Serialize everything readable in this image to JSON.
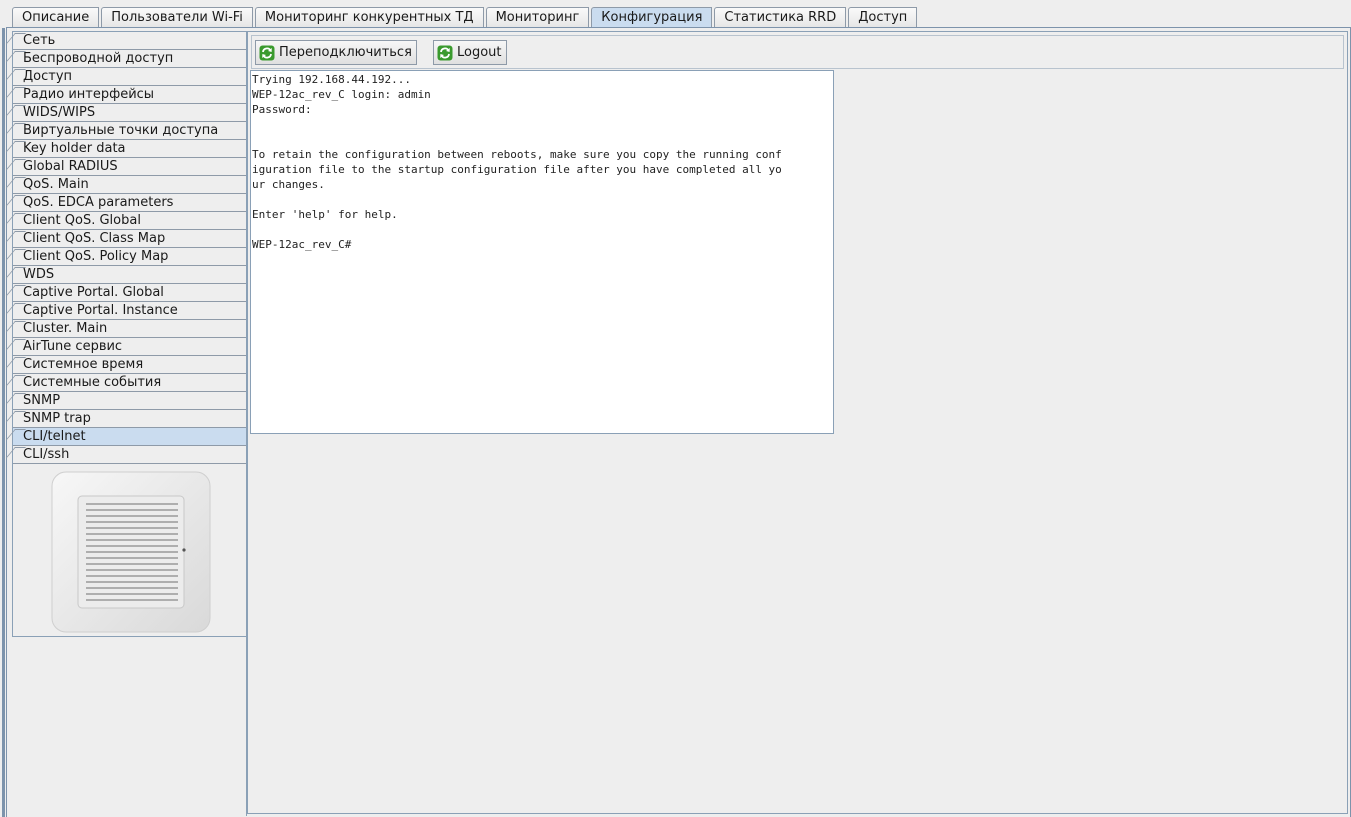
{
  "tabs": [
    {
      "label": "Описание"
    },
    {
      "label": "Пользователи Wi-Fi"
    },
    {
      "label": "Мониторинг конкурентных ТД"
    },
    {
      "label": "Мониторинг"
    },
    {
      "label": "Конфигурация"
    },
    {
      "label": "Статистика RRD"
    },
    {
      "label": "Доступ"
    }
  ],
  "active_tab": "Конфигурация",
  "sidebar": {
    "items": [
      {
        "label": "Сеть"
      },
      {
        "label": "Беспроводной доступ"
      },
      {
        "label": "Доступ"
      },
      {
        "label": "Радио интерфейсы"
      },
      {
        "label": "WIDS/WIPS"
      },
      {
        "label": "Виртуальные точки доступа"
      },
      {
        "label": "Key holder data"
      },
      {
        "label": "Global RADIUS"
      },
      {
        "label": "QoS. Main"
      },
      {
        "label": "QoS. EDCA parameters"
      },
      {
        "label": "Client QoS. Global"
      },
      {
        "label": "Client QoS. Class Map"
      },
      {
        "label": "Client QoS. Policy Map"
      },
      {
        "label": "WDS"
      },
      {
        "label": "Captive Portal. Global"
      },
      {
        "label": "Captive Portal. Instance"
      },
      {
        "label": "Cluster. Main"
      },
      {
        "label": "AirTune сервис"
      },
      {
        "label": "Системное время"
      },
      {
        "label": "Системные события"
      },
      {
        "label": "SNMP"
      },
      {
        "label": "SNMP trap"
      },
      {
        "label": "CLI/telnet"
      },
      {
        "label": "CLI/ssh"
      }
    ],
    "active_item": "CLI/telnet"
  },
  "toolbar": {
    "reconnect_label": "Переподключиться",
    "logout_label": "Logout"
  },
  "terminal": {
    "output": "Trying 192.168.44.192...\nWEP-12ac_rev_C login: admin\nPassword:\n\n\nTo retain the configuration between reboots, make sure you copy the running conf\niguration file to the startup configuration file after you have completed all yo\nur changes.\n\nEnter 'help' for help.\n\nWEP-12ac_rev_C#"
  },
  "colors": {
    "active_tab_bg": "#cadcef",
    "frame_border": "#7d93ab",
    "refresh_icon_green": "#3a9a2e"
  },
  "icons": {
    "reconnect": "refresh-icon",
    "logout": "refresh-icon"
  }
}
